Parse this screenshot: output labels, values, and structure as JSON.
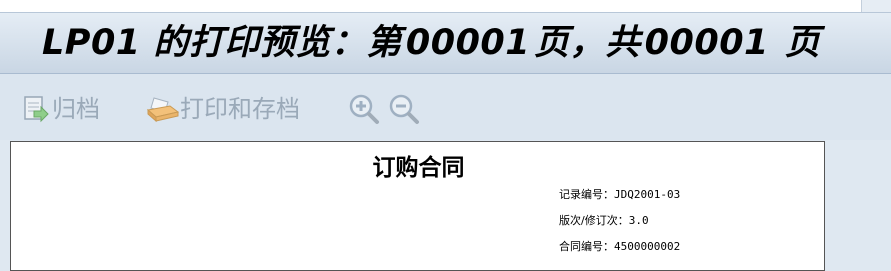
{
  "window": {
    "title_parts": [
      "LP01 的打印预览：第",
      "00001",
      "页，共",
      "00001",
      "页"
    ]
  },
  "toolbar": {
    "archive_label": "归档",
    "print_archive_label": "打印和存档"
  },
  "icons": {
    "archive": "archive-icon",
    "print_archive": "printer-icon",
    "zoom_in": "zoom-in-icon",
    "zoom_out": "zoom-out-icon"
  },
  "document": {
    "title": "订购合同",
    "fields": [
      {
        "label": "记录编号：",
        "value": "JDQ2001-03"
      },
      {
        "label": "版次/修订次：",
        "value": "3.0"
      },
      {
        "label": "合同编号：",
        "value": "4500000002"
      }
    ]
  },
  "colors": {
    "disabled_text": "#9aa9b8",
    "title_bar": "#c9d6e4"
  }
}
